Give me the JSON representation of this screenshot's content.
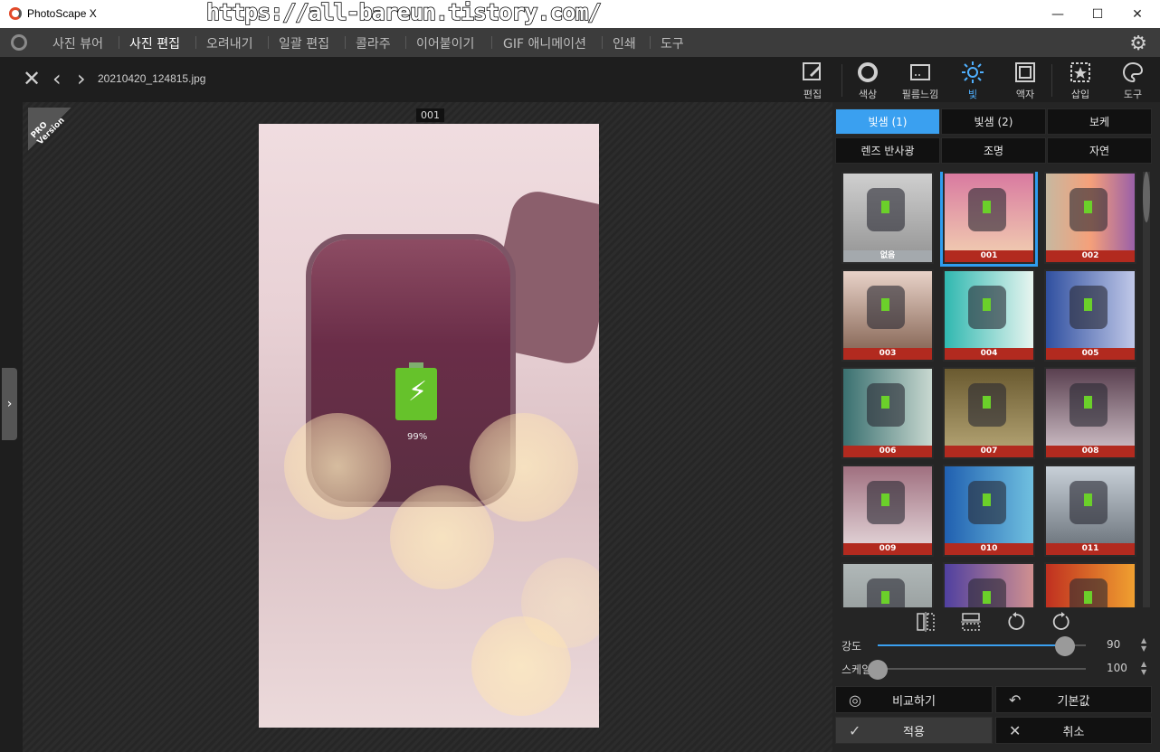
{
  "titlebar": {
    "app_title": "PhotoScape X",
    "watermark": "https://all-bareun.tistory.com/"
  },
  "menu": {
    "items": [
      "사진 뷰어",
      "사진 편집",
      "오려내기",
      "일괄 편집",
      "콜라주",
      "이어붙이기",
      "GIF 애니메이션",
      "인쇄",
      "도구"
    ],
    "active": "사진 편집"
  },
  "toolbar": {
    "filename": "20210420_124815.jpg",
    "tools": [
      "편집",
      "색상",
      "필름느낌",
      "빛",
      "액자",
      "삽입",
      "도구"
    ],
    "active_tool": "빛"
  },
  "canvas": {
    "page_number": "001",
    "pro_badge": "PRO Version",
    "battery_percent": "99%"
  },
  "panel": {
    "tabs": [
      "빛샘 (1)",
      "빛샘 (2)",
      "보케",
      "렌즈 반사광",
      "조명",
      "자연"
    ],
    "active_tab": "빛샘 (1)",
    "thumbnails": [
      "없음",
      "001",
      "002",
      "003",
      "004",
      "005",
      "006",
      "007",
      "008",
      "009",
      "010",
      "011",
      "",
      "",
      ""
    ],
    "selected_thumbnail": "001",
    "strength": {
      "label": "강도",
      "value": "90",
      "fraction": 0.9
    },
    "scale": {
      "label": "스케일",
      "value": "100",
      "fraction": 0.0
    },
    "buttons": {
      "compare": "비교하기",
      "default": "기본값",
      "apply": "적용",
      "cancel": "취소"
    }
  },
  "colors": {
    "accent": "#3aa0f0",
    "thumb_label": "#b22a1f",
    "selected_outline": "#2f9df0"
  }
}
